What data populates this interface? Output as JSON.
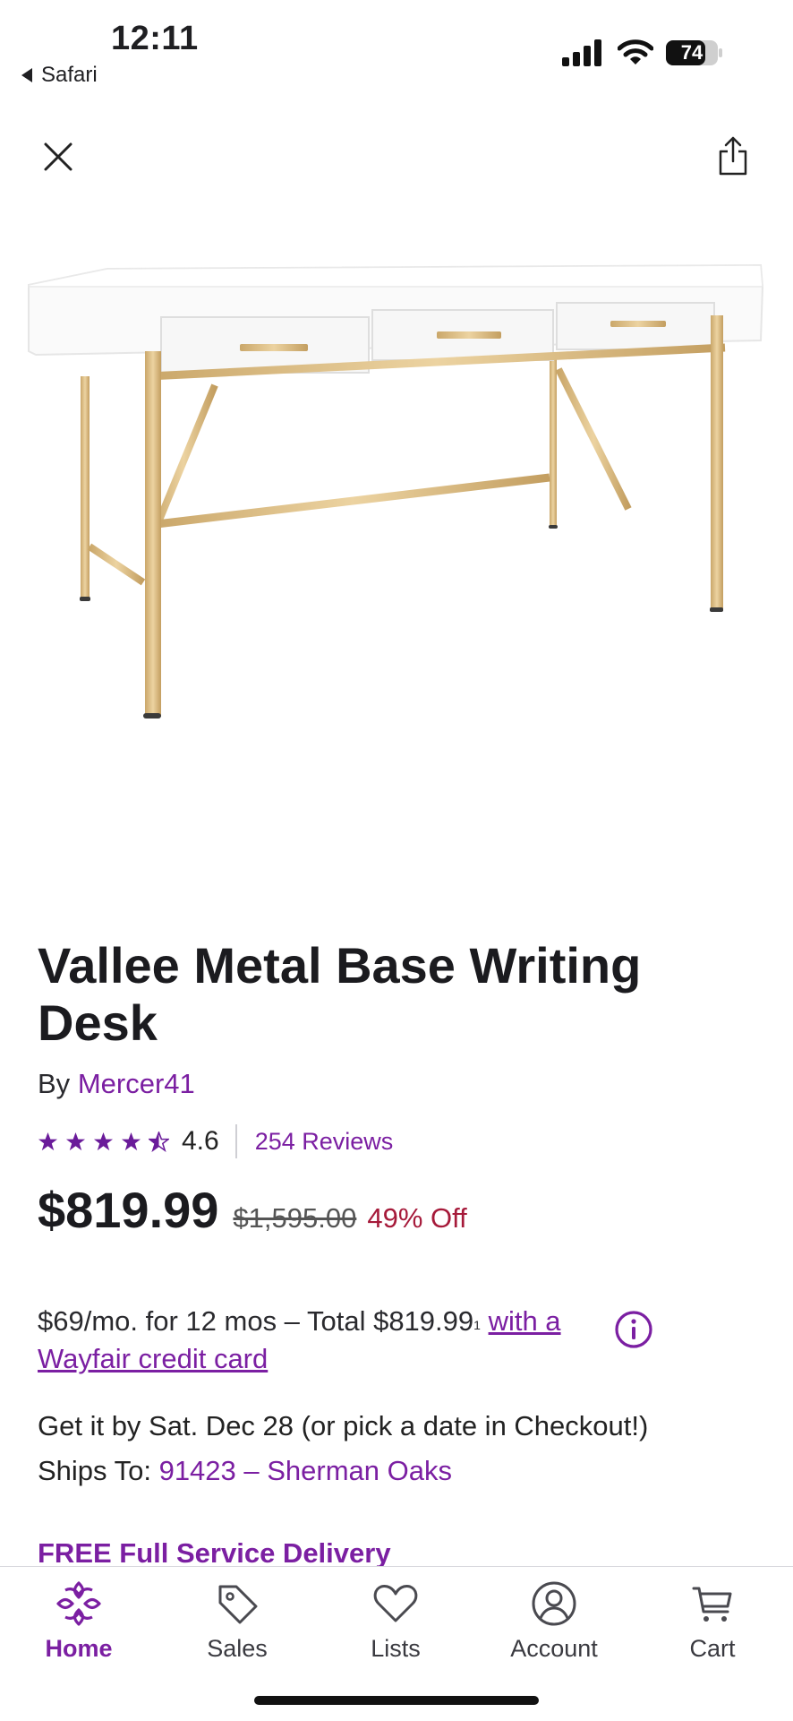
{
  "status_bar": {
    "time": "12:11",
    "back_app": "Safari",
    "battery": "74"
  },
  "product": {
    "title": "Vallee Metal Base Writing Desk",
    "by_prefix": "By",
    "brand": "Mercer41",
    "rating": "4.6",
    "rating_fraction": 0.92,
    "reviews": "254 Reviews",
    "price": "$819.99",
    "original_price": "$1,595.00",
    "discount": "49% Off"
  },
  "financing": {
    "text": "$69/mo. for 12 mos – Total $819.99",
    "footnote": "1",
    "link_part1": "with a",
    "link_part2": "Wayfair credit card"
  },
  "delivery": {
    "estimate": "Get it by Sat. Dec 28 (or pick a date in Checkout!)",
    "ships_label": "Ships To:",
    "ships_location": "91423 – Sherman Oaks",
    "free_delivery": "FREE Full Service Delivery"
  },
  "tabs": [
    {
      "label": "Home",
      "icon": "home-icon",
      "active": true
    },
    {
      "label": "Sales",
      "icon": "tag-icon",
      "active": false
    },
    {
      "label": "Lists",
      "icon": "heart-icon",
      "active": false
    },
    {
      "label": "Account",
      "icon": "account-icon",
      "active": false
    },
    {
      "label": "Cart",
      "icon": "cart-icon",
      "active": false
    }
  ],
  "colors": {
    "accent": "#7b1fa2",
    "discount": "#a61a3a",
    "text": "#1b1b1f"
  }
}
